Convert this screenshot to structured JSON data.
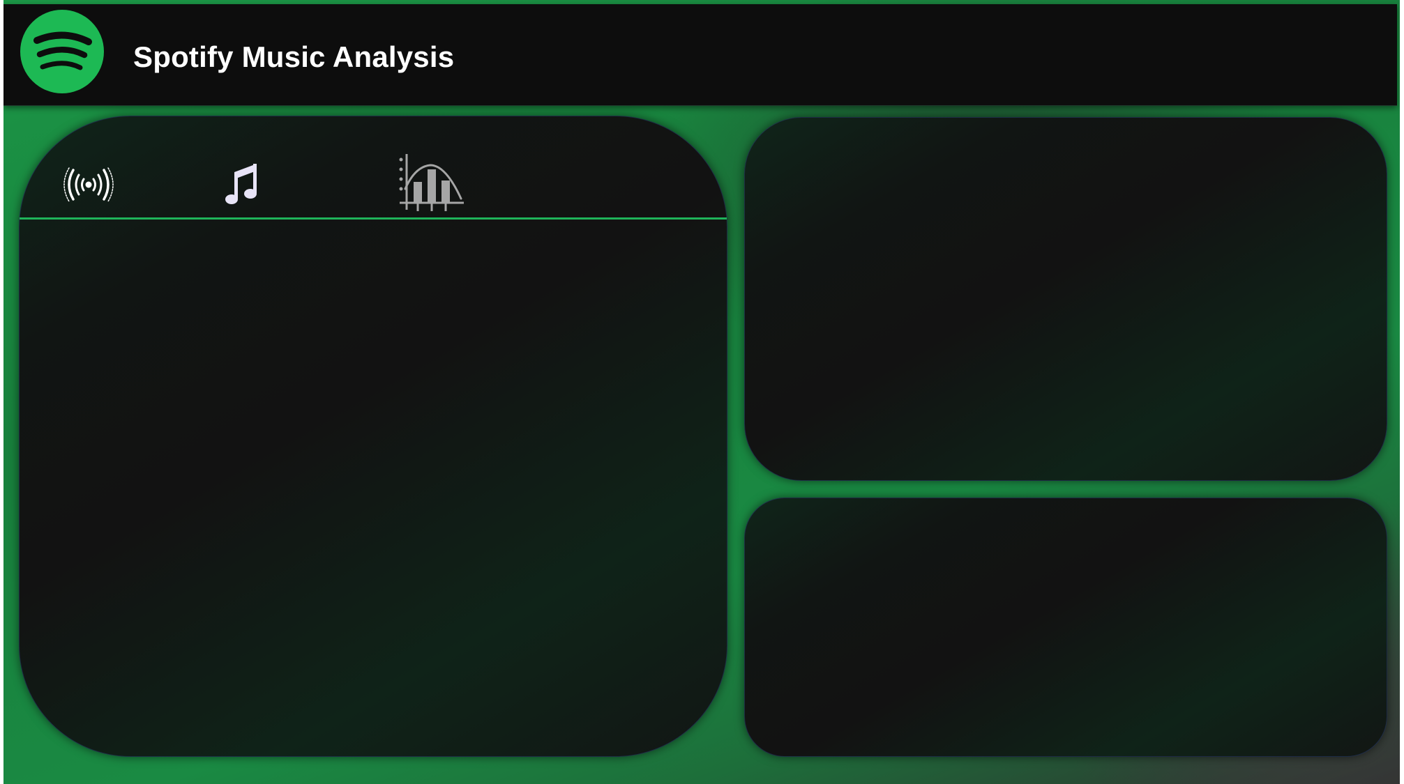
{
  "header": {
    "title": "Spotify Music Analysis",
    "logo_icon": "spotify-logo-icon"
  },
  "colors": {
    "brand_green": "#1DB954",
    "header_bg": "#0D0D0D",
    "card_bg": "#121212",
    "divider": "#1FB45A",
    "icon_light": "#E8E4F7",
    "icon_muted": "#A6A6A6"
  },
  "left_panel": {
    "tabs": [
      {
        "icon": "broadcast-icon"
      },
      {
        "icon": "music-note-icon"
      },
      {
        "icon": "histogram-bell-curve-icon"
      }
    ]
  },
  "right_panels": [
    {
      "name": "top-panel"
    },
    {
      "name": "bottom-panel"
    }
  ]
}
